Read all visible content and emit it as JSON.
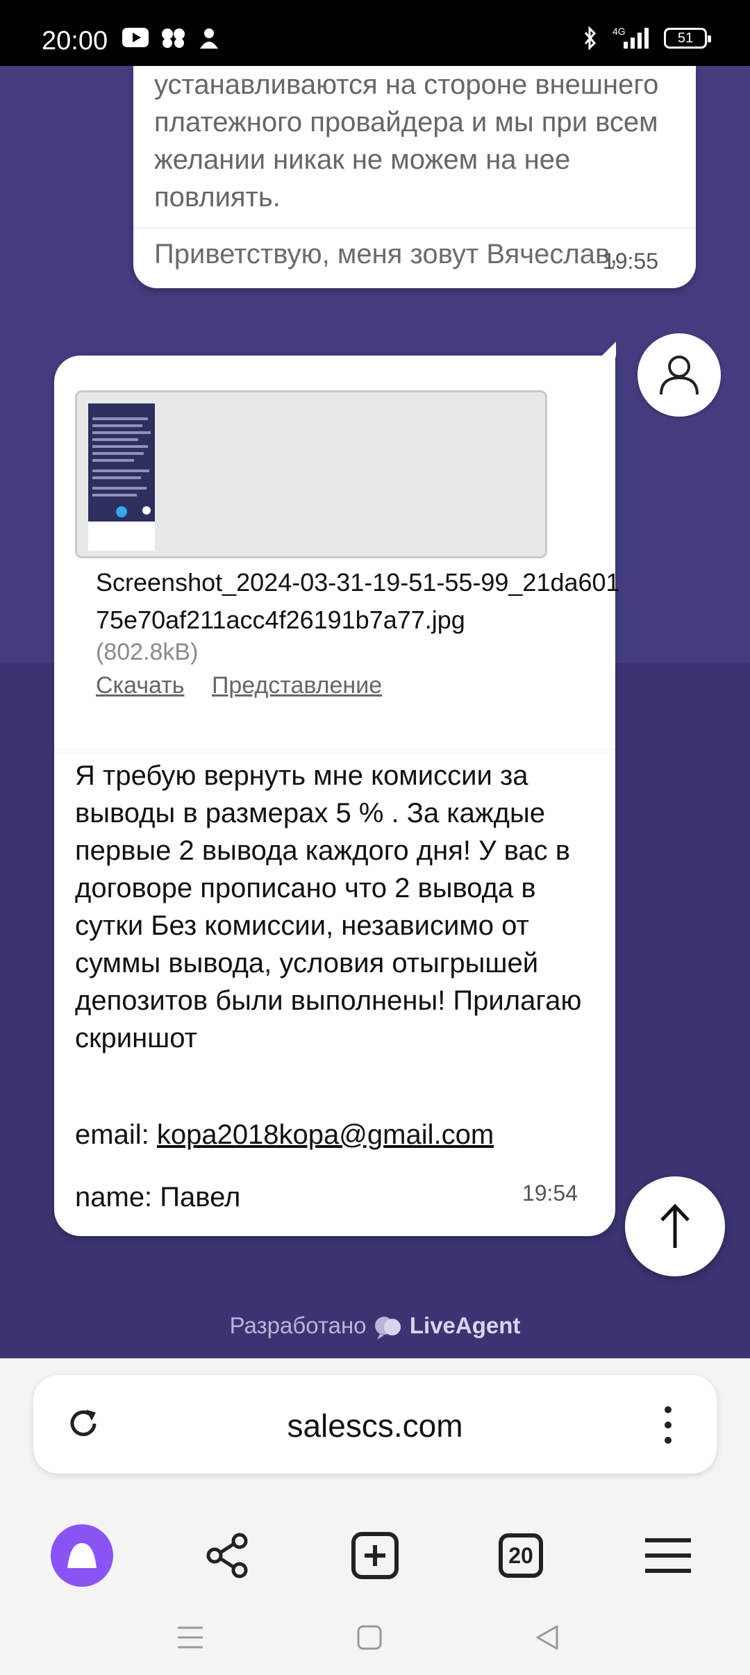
{
  "status_bar": {
    "time": "20:00",
    "network": "4G",
    "battery": "51",
    "icons": [
      "youtube-icon",
      "app-icon",
      "app-icon-2",
      "bluetooth-icon",
      "signal-icon",
      "battery-icon"
    ]
  },
  "agent_message": {
    "text": "устанавливаются на стороне внешнего платежного провайдера и мы при всем желании никак не можем на нее повлиять.",
    "next_text": "Приветствую, меня зовут Вячеслав,",
    "time": "19:55"
  },
  "user_message": {
    "attachment": {
      "filename": "Screenshot_2024-03-31-19-51-55-99_21da60175e70af211acc4f26191b7a77.jpg",
      "size": "(802.8kB)",
      "download_label": "Скачать",
      "view_label": "Представление"
    },
    "text": "Я требую вернуть мне комиссии за выводы в размерах 5 % . За каждые первые 2 вывода каждого дня! У вас в договоре прописано что 2 вывода в сутки Без комиссии, независимо от суммы вывода, условия отыгрышей депозитов были выполнены! Прилагаю скриншот",
    "email_label": "email:",
    "email": "kopa2018kopa@gmail.com",
    "name_line": "name: Павел",
    "time": "19:54"
  },
  "powered_by": {
    "prefix": "Разработано",
    "brand": "LiveAgent"
  },
  "browser": {
    "url": "salescs.com",
    "tabs_count": "20"
  },
  "colors": {
    "chat_bg": "#3a3572",
    "chat_bg_top": "#433d80",
    "alice": "#8a54f5"
  }
}
